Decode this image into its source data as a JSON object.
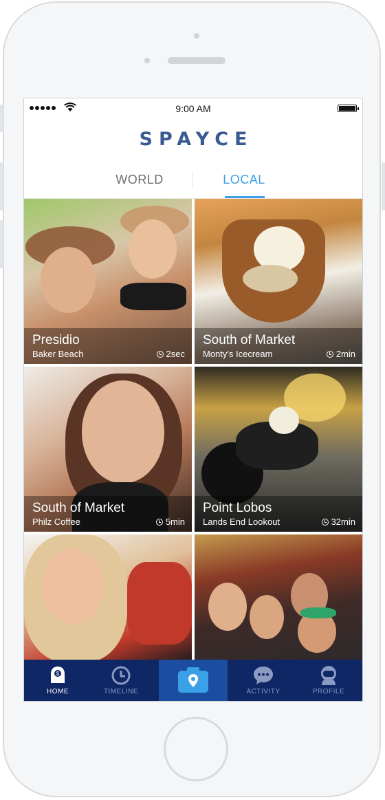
{
  "status_bar": {
    "time": "9:00 AM"
  },
  "app": {
    "logo": "SPAYCE"
  },
  "tabs": [
    {
      "label": "WORLD",
      "selected": false
    },
    {
      "label": "LOCAL",
      "selected": true
    }
  ],
  "posts": [
    {
      "place": "Presidio",
      "venue": "Baker Beach",
      "age": "2sec"
    },
    {
      "place": "South of Market",
      "venue": "Monty's Icecream",
      "age": "2min"
    },
    {
      "place": "South of Market",
      "venue": "Philz Coffee",
      "age": "5min"
    },
    {
      "place": "Point Lobos",
      "venue": "Lands End Lookout",
      "age": "32min"
    },
    {
      "place": "",
      "venue": "",
      "age": ""
    },
    {
      "place": "",
      "venue": "",
      "age": ""
    }
  ],
  "tabbar": [
    {
      "label": "HOME",
      "icon": "home-ghost-icon",
      "active": true
    },
    {
      "label": "TIMELINE",
      "icon": "clock-icon",
      "active": false
    },
    {
      "label": "",
      "icon": "camera-icon",
      "active": false
    },
    {
      "label": "ACTIVITY",
      "icon": "chat-bubble-icon",
      "active": false
    },
    {
      "label": "PROFILE",
      "icon": "astronaut-icon",
      "active": false
    }
  ],
  "colors": {
    "brand": "#3a5a92",
    "tab_active": "#3aa0e8",
    "tabbar_bg": "#0f2765",
    "camera_bg": "#1b4da0"
  }
}
